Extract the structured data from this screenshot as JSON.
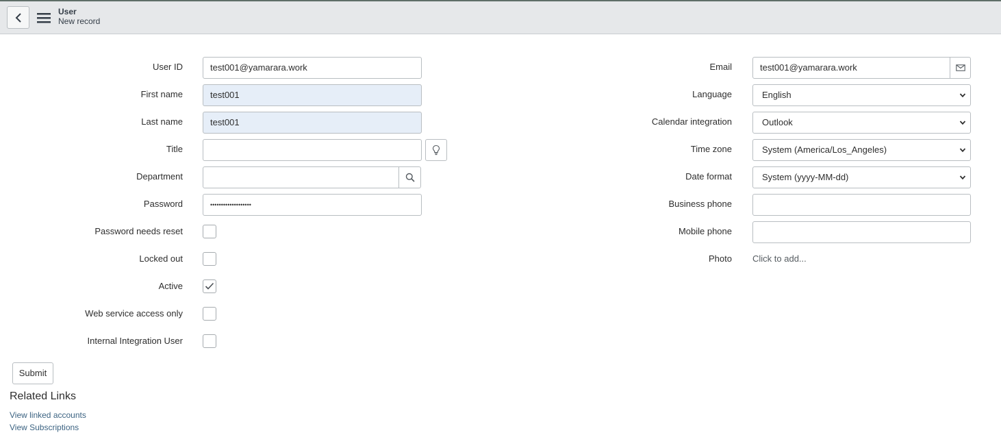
{
  "header": {
    "title": "User",
    "subtitle": "New record",
    "back_icon": "chevron-left-icon",
    "menu_icon": "hamburger-menu-icon"
  },
  "left_fields": {
    "user_id": {
      "label": "User ID",
      "value": "test001@yamarara.work"
    },
    "first_name": {
      "label": "First name",
      "value": "test001"
    },
    "last_name": {
      "label": "Last name",
      "value": "test001"
    },
    "title": {
      "label": "Title",
      "value": "",
      "addon_icon": "lightbulb-icon"
    },
    "department": {
      "label": "Department",
      "value": "",
      "addon_icon": "search-icon"
    },
    "password": {
      "label": "Password",
      "value": "•••••••••••••••••••"
    },
    "password_needs_reset": {
      "label": "Password needs reset",
      "checked": false
    },
    "locked_out": {
      "label": "Locked out",
      "checked": false
    },
    "active": {
      "label": "Active",
      "checked": true
    },
    "web_service_access_only": {
      "label": "Web service access only",
      "checked": false
    },
    "internal_integration_user": {
      "label": "Internal Integration User",
      "checked": false
    }
  },
  "right_fields": {
    "email": {
      "label": "Email",
      "value": "test001@yamarara.work",
      "addon_icon": "envelope-icon"
    },
    "language": {
      "label": "Language",
      "selected": "English"
    },
    "calendar_integration": {
      "label": "Calendar integration",
      "selected": "Outlook"
    },
    "time_zone": {
      "label": "Time zone",
      "selected": "System (America/Los_Angeles)"
    },
    "date_format": {
      "label": "Date format",
      "selected": "System (yyyy-MM-dd)"
    },
    "business_phone": {
      "label": "Business phone",
      "value": ""
    },
    "mobile_phone": {
      "label": "Mobile phone",
      "value": ""
    },
    "photo": {
      "label": "Photo",
      "link": "Click to add..."
    }
  },
  "submit_label": "Submit",
  "related_links": {
    "title": "Related Links",
    "links": [
      "View linked accounts",
      "View Subscriptions"
    ]
  },
  "colors": {
    "header_bg": "#e6e8ea",
    "readonly_bg": "#e6eef8",
    "link": "#3c6382"
  }
}
